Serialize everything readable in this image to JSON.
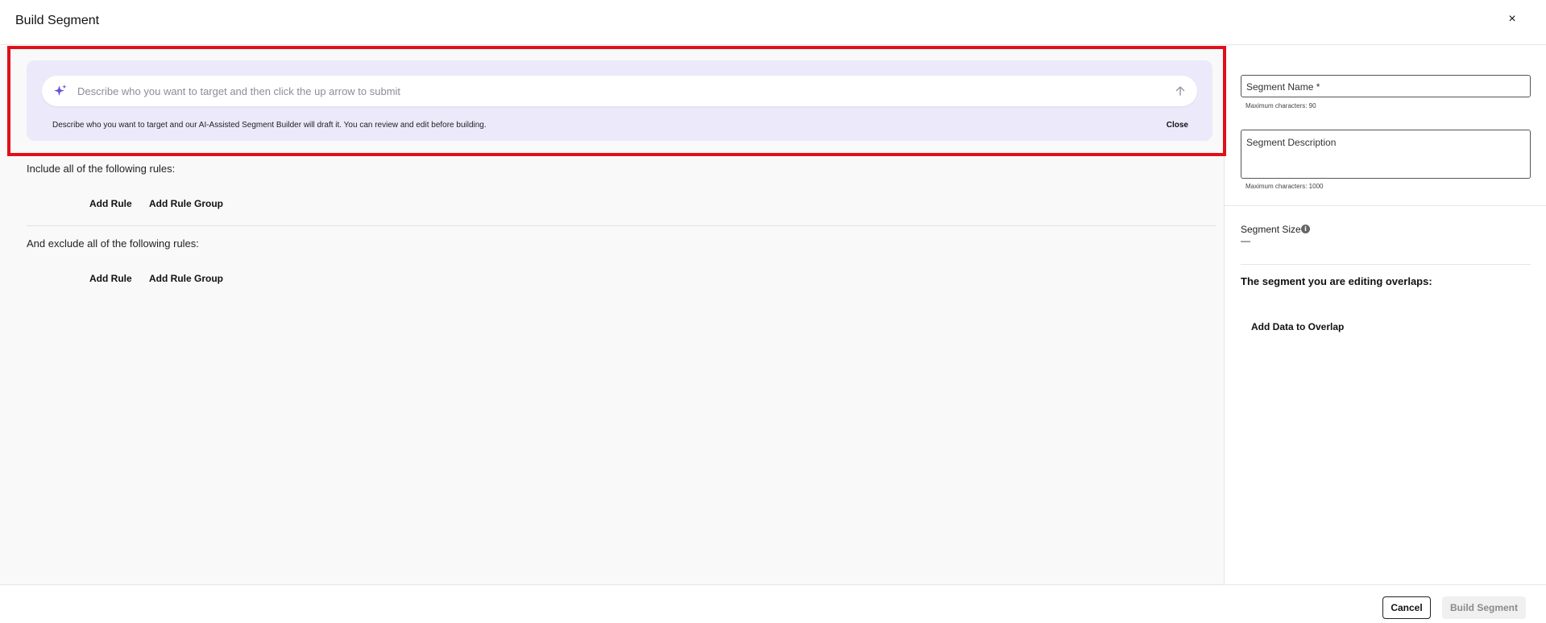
{
  "header": {
    "title": "Build Segment",
    "close_glyph": "×"
  },
  "ai_builder": {
    "placeholder": "Describe who you want to target and then click the up arrow to submit",
    "help_text": "Describe who you want to target and our AI-Assisted Segment Builder will draft it. You can review and edit before building.",
    "close_label": "Close",
    "sparkle_icon": "sparkle-icon",
    "submit_icon": "arrow-up-icon",
    "accent_color": "#6a4fd8",
    "panel_color": "#ece9fb"
  },
  "include_section": {
    "label": "Include all of the following rules:",
    "add_rule": "Add Rule",
    "add_rule_group": "Add Rule Group"
  },
  "exclude_section": {
    "label": "And exclude all of the following rules:",
    "add_rule": "Add Rule",
    "add_rule_group": "Add Rule Group"
  },
  "side_panel": {
    "name_label": "Segment Name *",
    "name_hint": "Maximum characters: 90",
    "description_label": "Segment Description",
    "description_hint": "Maximum characters: 1000",
    "size_label": "Segment Size",
    "size_value": "—",
    "overlap_title": "The segment you are editing overlaps:",
    "add_overlap": "Add Data to Overlap"
  },
  "footer": {
    "cancel": "Cancel",
    "build": "Build Segment"
  },
  "highlight_color": "#e0101a"
}
